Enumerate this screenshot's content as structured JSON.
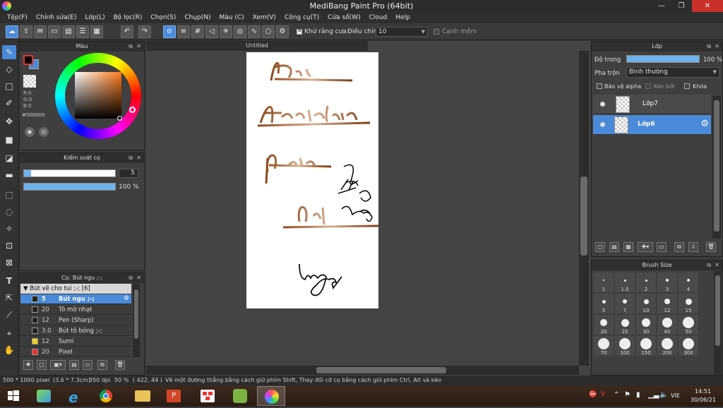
{
  "window": {
    "title": "MediBang Paint Pro (64bit)",
    "min": "—",
    "max": "❐",
    "close": "✕"
  },
  "menu": [
    "Tệp(F)",
    "Chỉnh sửa(E)",
    "Lớp(L)",
    "Bộ lọc(R)",
    "Chọn(S)",
    "Chụp(N)",
    "Màu (C)",
    "Xem(V)",
    "Công cụ(T)",
    "Cửa sổ(W)",
    "Cloud",
    "Help"
  ],
  "toolbar": {
    "antialias_label": "Khử răng cưa",
    "antialias_checked": true,
    "correction_label": "Điều chỉnh",
    "correction_value": "10",
    "edge_label": "Cạnh mềm",
    "edge_checked": false
  },
  "color_panel": {
    "title": "Màu",
    "r": "R:0",
    "g": "G:0",
    "b": "B:0",
    "hex": "#000000",
    "fg_color": "#000000",
    "bg_color": "#4a8ad8"
  },
  "brush_control": {
    "title": "Kiểm soát cọ",
    "size": "5",
    "opacity": "100 %"
  },
  "brush_panel": {
    "title": "Cọ: Bút ngu ;-;",
    "group": "Bút vẽ cho tui ;-; [6]",
    "items": [
      {
        "size": "5",
        "name": "Bút ngu ;-;",
        "color": "#222222",
        "selected": true
      },
      {
        "size": "20",
        "name": "Tô mờ nhạt",
        "color": "#222222"
      },
      {
        "size": "12",
        "name": "Pen (Sharp)",
        "color": "#222222"
      },
      {
        "size": "3.0",
        "name": "Bút tô bóng ;-;",
        "color": "#222222"
      },
      {
        "size": "12",
        "name": "Sumi",
        "color": "#f0d020"
      },
      {
        "size": "20",
        "name": "Pixel",
        "color": "#e83030"
      }
    ]
  },
  "document": {
    "tab_title": "Untitled"
  },
  "layer_panel": {
    "title": "Lớp",
    "opacity_label": "Độ trong",
    "opacity_value": "100 %",
    "opacity_fraction": 1.0,
    "blend_label": "Pha trộn",
    "blend_value": "Bình thường",
    "protect_alpha": "Bảo vệ alpha",
    "clipping": "Xén bớt",
    "lock": "Khóa",
    "layers": [
      {
        "name": "Lớp7",
        "selected": false
      },
      {
        "name": "Lớp6",
        "selected": true
      }
    ]
  },
  "brush_size_panel": {
    "title": "Brush Size",
    "sizes": [
      "1",
      "1.5",
      "2",
      "3",
      "4",
      "5",
      "7",
      "10",
      "12",
      "15",
      "20",
      "25",
      "30",
      "40",
      "50",
      "70",
      "100",
      "150",
      "200",
      "300"
    ]
  },
  "status_bar": {
    "dimensions": "500 * 1000 pixel",
    "physical": "(3.6 * 7.3cm)",
    "dpi": "350 dpi",
    "zoom": "50 %",
    "coords": "( 422, 44 )",
    "hint": "Vẽ một đường thẳng bằng cách giữ phím Shift, Thay đổi cỡ cọ bằng cách giữ phím Ctrl, Alt và kéo"
  },
  "taskbar": {
    "language": "VIE",
    "time": "14:51",
    "date": "30/06/21"
  }
}
